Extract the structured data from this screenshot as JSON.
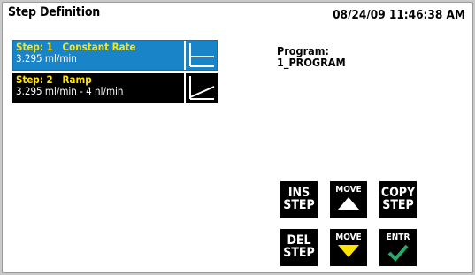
{
  "header": {
    "title": "Step Definition",
    "datetime": "08/24/09 11:46:38 AM"
  },
  "steps": [
    {
      "name": "Step: 1   Constant Rate",
      "rate": "3.295 ml/min",
      "icon": "constant-rate-icon",
      "selected": true,
      "color": "#1a84c8"
    },
    {
      "name": "Step: 2   Ramp",
      "rate": "3.295 ml/min - 4 nl/min",
      "icon": "ramp-icon",
      "selected": false,
      "color": "#000000"
    }
  ],
  "program": {
    "label": "Program:",
    "value": "1_PROGRAM"
  },
  "buttons": {
    "ins_step": {
      "line1": "INS",
      "line2": "STEP"
    },
    "move_up": {
      "label": "MOVE",
      "icon": "triangle-up-icon",
      "icon_color": "#ffffff"
    },
    "copy_step": {
      "line1": "COPY",
      "line2": "STEP"
    },
    "del_step": {
      "line1": "DEL",
      "line2": "STEP"
    },
    "move_down": {
      "label": "MOVE",
      "icon": "triangle-down-icon",
      "icon_color": "#ffe400"
    },
    "enter": {
      "label": "ENTR",
      "icon": "checkmark-icon",
      "icon_color": "#2aa86a"
    }
  }
}
